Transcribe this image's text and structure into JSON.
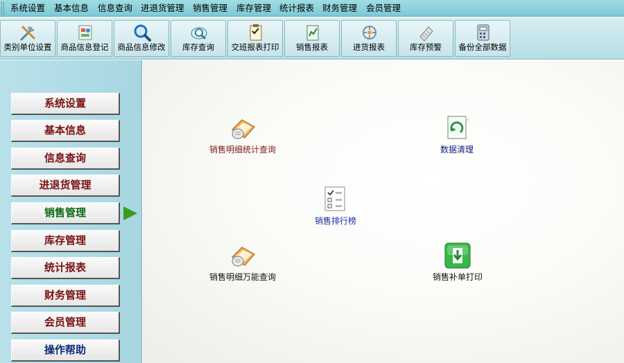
{
  "menu": [
    "系统设置",
    "基本信息",
    "信息查询",
    "进退货管理",
    "销售管理",
    "库存管理",
    "统计报表",
    "财务管理",
    "会员管理"
  ],
  "toolbar": [
    {
      "label": "类别单位设置",
      "icon": "tools-icon"
    },
    {
      "label": "商品信息登记",
      "icon": "product-register-icon"
    },
    {
      "label": "商品信息修改",
      "icon": "magnifier-icon"
    },
    {
      "label": "库存查询",
      "icon": "inventory-query-icon"
    },
    {
      "label": "交班报表打印",
      "icon": "shift-report-icon"
    },
    {
      "label": "销售报表",
      "icon": "sales-report-icon"
    },
    {
      "label": "进货报表",
      "icon": "purchase-report-icon"
    },
    {
      "label": "库存预警",
      "icon": "inventory-alert-icon"
    },
    {
      "label": "备份全部数据",
      "icon": "calculator-icon"
    }
  ],
  "sidebar": {
    "active": "销售管理",
    "items": [
      "系统设置",
      "基本信息",
      "信息查询",
      "进退货管理",
      "销售管理",
      "库存管理",
      "统计报表",
      "财务管理",
      "会员管理",
      "操作帮助"
    ]
  },
  "functions": {
    "detail_stats": {
      "label": "销售明细统计查询",
      "icon": "query-hand-icon",
      "color": "#7a1a1a"
    },
    "data_cleanup": {
      "label": "数据清理",
      "icon": "data-refresh-icon",
      "color": "#0d1a80"
    },
    "ranking": {
      "label": "销售排行榜",
      "icon": "checklist-icon",
      "color": "#1a2fa0"
    },
    "detail_all": {
      "label": "销售明细万能查询",
      "icon": "query-hand-icon",
      "color": "#111111"
    },
    "reprint": {
      "label": "销售补单打印",
      "icon": "green-download-icon",
      "color": "#111111"
    }
  }
}
